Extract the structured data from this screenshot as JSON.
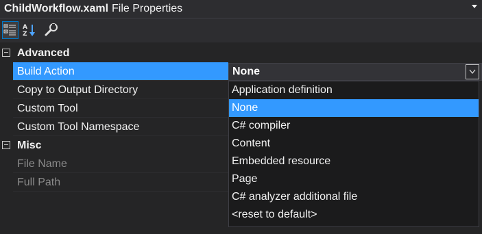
{
  "title": {
    "file_name": "ChildWorkflow.xaml",
    "panel": "File Properties"
  },
  "toolbar": {
    "categorized_icon": "categorized-icon",
    "alphabetical_icon": "alphabetical-icon",
    "property_pages_icon": "wrench-icon"
  },
  "categories": [
    {
      "label": "Advanced",
      "properties": [
        {
          "name": "Build Action",
          "value": "None"
        },
        {
          "name": "Copy to Output Directory",
          "value": ""
        },
        {
          "name": "Custom Tool",
          "value": ""
        },
        {
          "name": "Custom Tool Namespace",
          "value": ""
        }
      ]
    },
    {
      "label": "Misc",
      "properties": [
        {
          "name": "File Name",
          "value": ""
        },
        {
          "name": "Full Path",
          "value": ""
        }
      ]
    }
  ],
  "dropdown": {
    "selected": "None",
    "options": [
      "Application definition",
      "None",
      "C# compiler",
      "Content",
      "Embedded resource",
      "Page",
      "C# analyzer additional file",
      "<reset to default>"
    ]
  },
  "colors": {
    "background": "#252526",
    "selection": "#3399ff",
    "accent": "#007acc"
  }
}
